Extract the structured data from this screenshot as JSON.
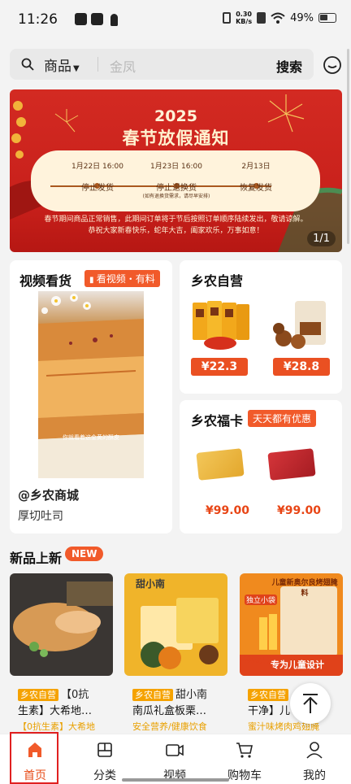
{
  "status": {
    "time": "11:26",
    "net_value": "0.30",
    "net_unit": "KB/s",
    "battery": "49%"
  },
  "search": {
    "category": "商品",
    "placeholder": "金凤",
    "button": "搜索"
  },
  "banner": {
    "year": "2025",
    "title": "春节放假通知",
    "milestones": [
      {
        "date": "1月22日 16:00",
        "label": "停止发货",
        "note": ""
      },
      {
        "date": "1月23日 16:00",
        "label": "停止退换货",
        "note": "(如有退换货需求，请尽早安排)"
      },
      {
        "date": "2月13日",
        "label": "恢复发货",
        "note": ""
      }
    ],
    "notice1": "春节期间商品正常销售，此期间订单将于节后按照订单顺序陆续发出，敬请谅解。",
    "notice2": "恭祝大家新春快乐，蛇年大吉，阖家欢乐，万事如意！",
    "pager": "1/1"
  },
  "video": {
    "title": "视频看货",
    "tag": "看视频・有料",
    "caption": "你就看着这金黄的酥皮",
    "shop": "@乡农商城",
    "product": "厚切吐司"
  },
  "self": {
    "title": "乡农自营",
    "prices": [
      "¥22.3",
      "¥28.8"
    ]
  },
  "fuka": {
    "title": "乡农福卡",
    "tag": "天天都有优惠",
    "prices": [
      "¥99.00",
      "¥99.00"
    ]
  },
  "new": {
    "title": "新品上新",
    "badge": "NEW",
    "items": [
      {
        "tag": "乡农自营",
        "name": "【0抗",
        "line2": "生素】大希地…",
        "sub": "【0抗生素】大希地"
      },
      {
        "tag": "乡农自营",
        "name": "甜小南",
        "line2": "南瓜礼盒板栗…",
        "sub": "安全营养/健康饮食"
      },
      {
        "tag": "乡农自营",
        "name": "【",
        "line2": "干净】儿",
        "sub": "蜜汁味烤肉鸡翅腌"
      }
    ],
    "brand2": "甜小南",
    "brand3_title": "儿童新奥尔良烤翅腌料",
    "brand3_badge": "独立小袋",
    "brand3_foot": "专为儿童设计",
    "brand3_side": "零添加剂"
  },
  "tabs": [
    {
      "label": "首页",
      "icon": "home-icon"
    },
    {
      "label": "分类",
      "icon": "category-icon"
    },
    {
      "label": "视频",
      "icon": "video-icon"
    },
    {
      "label": "购物车",
      "icon": "cart-icon"
    },
    {
      "label": "我的",
      "icon": "profile-icon"
    }
  ],
  "colors": {
    "accent": "#E74B17",
    "banner_red": "#C8201B",
    "tag_orange": "#F5A200"
  }
}
